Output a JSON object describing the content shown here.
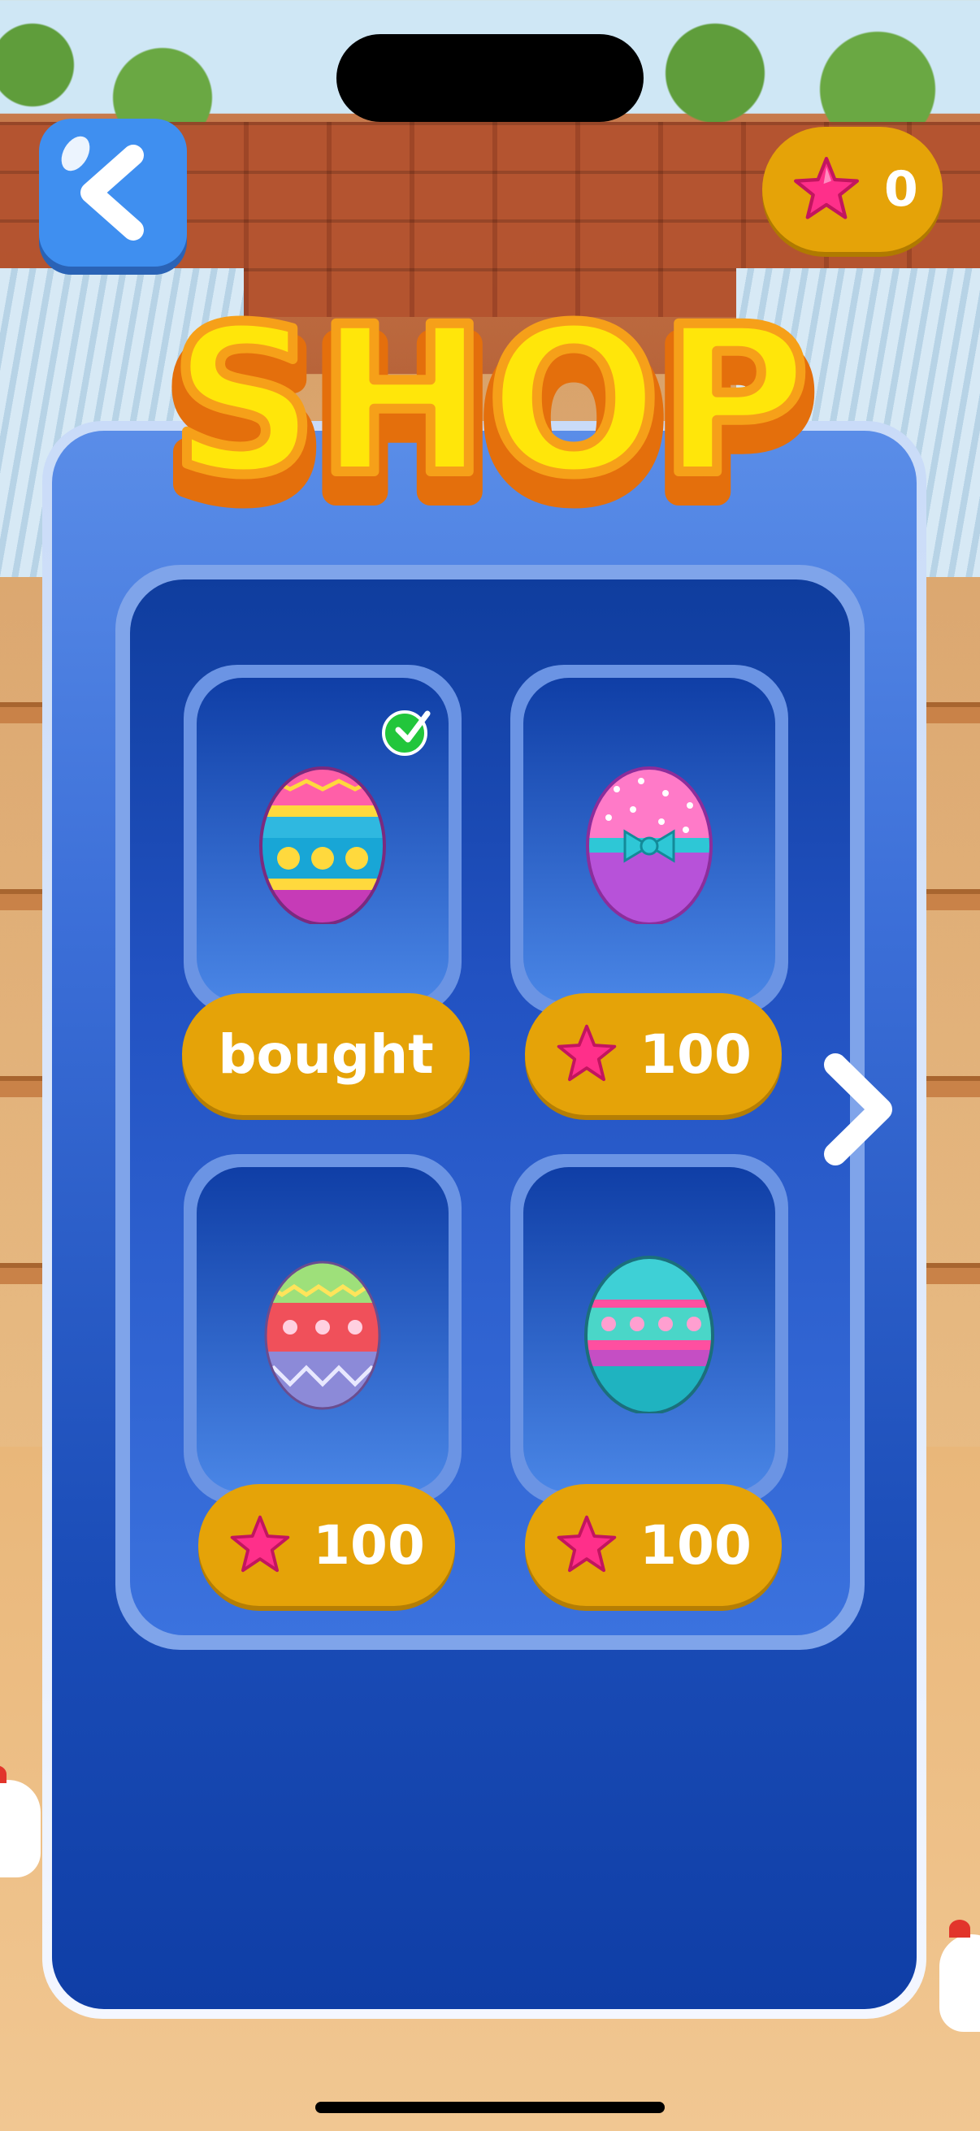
{
  "header": {
    "back_icon": "chevron-left-icon",
    "stars": {
      "icon": "star-icon",
      "count": "0"
    }
  },
  "title": "SHOP",
  "items": [
    {
      "egg": "egg-pink-blue-patterned",
      "status": "bought",
      "owned": true
    },
    {
      "egg": "egg-pink-polka-bow",
      "price": "100",
      "price_icon": "star-icon"
    },
    {
      "egg": "egg-green-red-zigzag",
      "price": "100",
      "price_icon": "star-icon"
    },
    {
      "egg": "egg-teal-floral-stripes",
      "price": "100",
      "price_icon": "star-icon"
    }
  ],
  "navigation": {
    "next_icon": "chevron-right-icon"
  },
  "colors": {
    "primary_blue": "#3c6fd8",
    "badge_orange": "#e5a308",
    "title_yellow": "#ffe60a",
    "title_outline": "#f08a14",
    "star_pink": "#ff2f8a",
    "check_green": "#22c63b"
  }
}
